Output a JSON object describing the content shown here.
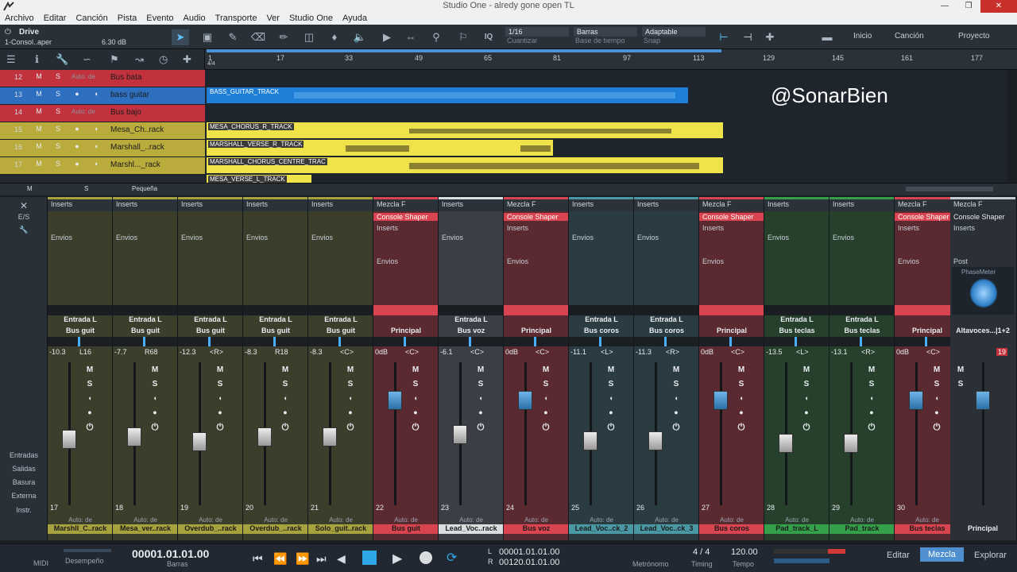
{
  "window": {
    "title": "Studio One - alredy gone open TL"
  },
  "menu": [
    "Archivo",
    "Editar",
    "Canción",
    "Pista",
    "Evento",
    "Audio",
    "Transporte",
    "Ver",
    "Studio One",
    "Ayuda"
  ],
  "toolbar": {
    "preset_name": "Drive",
    "preset_sub": "1-Consol..aper",
    "preset_db": "6.30 dB",
    "quantize_value": "1/16",
    "quantize_label": "Cuantizar",
    "timebase_value": "Barras",
    "timebase_label": "Base de tiempo",
    "snap_value": "Adaptable",
    "snap_label": "Snap",
    "iq_label": "IQ",
    "nav_inicio": "Inicio",
    "nav_cancion": "Canción",
    "nav_proyecto": "Proyecto"
  },
  "ruler": {
    "ticks": [
      "1",
      "17",
      "33",
      "49",
      "65",
      "81",
      "97",
      "113",
      "129",
      "145",
      "161",
      "177"
    ],
    "meter": "4/4"
  },
  "tracks": [
    {
      "num": "12",
      "name": "Bus bata",
      "auto": "Auto: de",
      "color": "#c2323d"
    },
    {
      "num": "13",
      "name": "bass guitar",
      "auto": "",
      "color": "#2e6fbf"
    },
    {
      "num": "14",
      "name": "Bus bajo",
      "auto": "Auto: de",
      "color": "#c2323d"
    },
    {
      "num": "15",
      "name": "Mesa_Ch..rack",
      "auto": "",
      "color": "#b9ac3c"
    },
    {
      "num": "16",
      "name": "Marshall_..rack",
      "auto": "",
      "color": "#b9ac3c"
    },
    {
      "num": "17",
      "name": "Marshl..._rack",
      "auto": "",
      "color": "#b9ac3c"
    }
  ],
  "track_buttons": {
    "m": "M",
    "s": "S"
  },
  "clips": [
    {
      "label": "BASS_GUITAR_TRACK",
      "color": "#1f7fd6"
    },
    {
      "label": "MESA_CHORUS_R_TRACK",
      "color": "#f0e34a"
    },
    {
      "label": "MARSHALL_VERSE_R_TRACK",
      "color": "#f0e34a"
    },
    {
      "label": "MARSHALL_CHORUS_CENTRE_TRAC",
      "color": "#f0e34a"
    },
    {
      "label": "MESA_VERSE_L_TRACK",
      "color": "#f0e34a"
    }
  ],
  "watermark": "@SonarBien",
  "bottom_row": {
    "m": "M",
    "s": "S",
    "size": "Pequeña"
  },
  "mixer_left": {
    "es": "E/S",
    "entradas": "Entradas",
    "salidas": "Salidas",
    "basura": "Basura",
    "externa": "Externa",
    "instr": "Instr."
  },
  "mixer_labels": {
    "inserts": "Inserts",
    "envios": "Envios",
    "auto": "Auto: de",
    "console": "Console Shaper",
    "mezcla": "Mezcla F",
    "post": "Post",
    "phasemeter": "PhaseMeter"
  },
  "channels": [
    {
      "num": "17",
      "input": "Entrada L",
      "output": "Bus guit",
      "vol": "-10.3",
      "pan": "L16",
      "name": "Marshll_C..rack",
      "color": "#a6a23d",
      "bg": "#3c3e2c",
      "bus": false
    },
    {
      "num": "18",
      "input": "Entrada L",
      "output": "Bus guit",
      "vol": "-7.7",
      "pan": "R68",
      "name": "Mesa_ver..rack",
      "color": "#a6a23d",
      "bg": "#3c3e2c",
      "bus": false
    },
    {
      "num": "19",
      "input": "Entrada L",
      "output": "Bus guit",
      "vol": "-12.3",
      "pan": "<R>",
      "name": "Overdub_..rack",
      "color": "#a6a23d",
      "bg": "#3c3e2c",
      "bus": false
    },
    {
      "num": "20",
      "input": "Entrada L",
      "output": "Bus guit",
      "vol": "-8.3",
      "pan": "R18",
      "name": "Overdub_..rack",
      "color": "#a6a23d",
      "bg": "#3c3e2c",
      "bus": false
    },
    {
      "num": "21",
      "input": "Entrada L",
      "output": "Bus guit",
      "vol": "-8.3",
      "pan": "<C>",
      "name": "Solo_guit..rack",
      "color": "#a6a23d",
      "bg": "#3c3e2c",
      "bus": false
    },
    {
      "num": "22",
      "input": "",
      "output": "Principal",
      "vol": "0dB",
      "pan": "<C>",
      "name": "Bus guit",
      "color": "#d8444f",
      "bg": "#5a2a30",
      "bus": true
    },
    {
      "num": "23",
      "input": "Entrada L",
      "output": "Bus voz",
      "vol": "-6.1",
      "pan": "<C>",
      "name": "Lead_Voc..rack",
      "color": "#d9dde0",
      "bg": "#3b3f45",
      "bus": false
    },
    {
      "num": "24",
      "input": "",
      "output": "Principal",
      "vol": "0dB",
      "pan": "<C>",
      "name": "Bus voz",
      "color": "#d8444f",
      "bg": "#5a2a30",
      "bus": true
    },
    {
      "num": "25",
      "input": "Entrada L",
      "output": "Bus coros",
      "vol": "-11.1",
      "pan": "<L>",
      "name": "Lead_Voc..ck_2",
      "color": "#4a98a4",
      "bg": "#2a3c42",
      "bus": false
    },
    {
      "num": "26",
      "input": "Entrada L",
      "output": "Bus coros",
      "vol": "-11.3",
      "pan": "<R>",
      "name": "Lead_Voc..ck_3",
      "color": "#4a98a4",
      "bg": "#2a3c42",
      "bus": false
    },
    {
      "num": "27",
      "input": "",
      "output": "Principal",
      "vol": "0dB",
      "pan": "<C>",
      "name": "Bus coros",
      "color": "#d8444f",
      "bg": "#5a2a30",
      "bus": true
    },
    {
      "num": "28",
      "input": "Entrada L",
      "output": "Bus teclas",
      "vol": "-13.5",
      "pan": "<L>",
      "name": "Pad_track_L",
      "color": "#35a04a",
      "bg": "#26402c",
      "bus": false
    },
    {
      "num": "29",
      "input": "Entrada L",
      "output": "Bus teclas",
      "vol": "-13.1",
      "pan": "<R>",
      "name": "Pad_track",
      "color": "#35a04a",
      "bg": "#26402c",
      "bus": false
    },
    {
      "num": "30",
      "input": "",
      "output": "Principal",
      "vol": "0dB",
      "pan": "<C>",
      "name": "Bus teclas",
      "color": "#d8444f",
      "bg": "#5a2a30",
      "bus": true
    }
  ],
  "main_channel": {
    "output": "Altavoces...|1+2",
    "name": "Principal",
    "peak": "19"
  },
  "transport": {
    "midi": "MIDI",
    "performance": "Desempeño",
    "position": "00001.01.01.00",
    "position_unit": "Barras",
    "loop_l_label": "L",
    "loop_l": "00001.01.01.00",
    "loop_r_label": "R",
    "loop_r": "00120.01.01.00",
    "metronome": "Metrónomo",
    "signature": "4 / 4",
    "timing": "Timing",
    "tempo": "120.00",
    "tempo_label": "Tempo"
  },
  "nav": {
    "editar": "Editar",
    "mezcla": "Mezcla",
    "explorar": "Explorar"
  }
}
